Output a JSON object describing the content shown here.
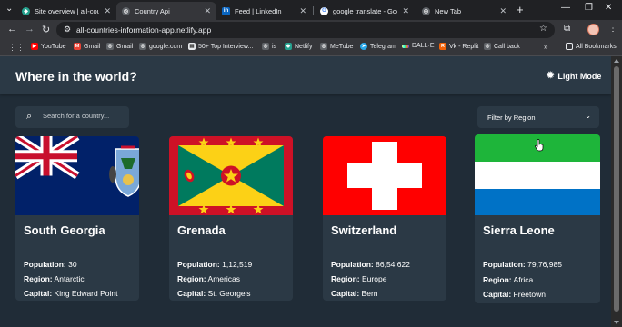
{
  "browser": {
    "tabs": [
      {
        "title": "Site overview | all-countries",
        "favicon": "netlify-icon"
      },
      {
        "title": "Country Api",
        "favicon": "globe-icon"
      },
      {
        "title": "Feed | LinkedIn",
        "favicon": "linkedin-icon"
      },
      {
        "title": "google translate - Google",
        "favicon": "google-icon"
      },
      {
        "title": "New Tab",
        "favicon": "chrome-icon"
      }
    ],
    "new_tab_label": "+",
    "url": "all-countries-information-app.netlify.app",
    "bookmarks": [
      {
        "label": "YouTube",
        "icon": "youtube-icon"
      },
      {
        "label": "Gmail",
        "icon": "gmail-icon"
      },
      {
        "label": "Gmail",
        "icon": "globe-icon"
      },
      {
        "label": "google.com",
        "icon": "globe-icon"
      },
      {
        "label": "50+ Top Interview...",
        "icon": "bookmark-icon"
      },
      {
        "label": "is",
        "icon": "globe-icon"
      },
      {
        "label": "Netlify",
        "icon": "netlify-icon"
      },
      {
        "label": "MeTube",
        "icon": "globe-icon"
      },
      {
        "label": "Telegram",
        "icon": "telegram-icon"
      },
      {
        "label": "DALL·E",
        "icon": "dalle-icon"
      },
      {
        "label": "Vk - Replit",
        "icon": "replit-icon"
      },
      {
        "label": "Call back",
        "icon": "globe-icon"
      }
    ],
    "all_bookmarks_label": "All Bookmarks"
  },
  "app": {
    "title": "Where in the world?",
    "mode_toggle_label": "Light Mode",
    "search_placeholder": "Search for a country...",
    "region_filter_label": "Filter by Region",
    "labels": {
      "population": "Population:",
      "region": "Region:",
      "capital": "Capital:"
    },
    "colors": {
      "background": "#202c37",
      "elements": "#2b3945",
      "text": "#ffffff"
    },
    "countries": [
      {
        "name": "South Georgia",
        "population": "30",
        "region": "Antarctic",
        "capital": "King Edward Point"
      },
      {
        "name": "Grenada",
        "population": "1,12,519",
        "region": "Americas",
        "capital": "St. George's"
      },
      {
        "name": "Switzerland",
        "population": "86,54,622",
        "region": "Europe",
        "capital": "Bern"
      },
      {
        "name": "Sierra Leone",
        "population": "79,76,985",
        "region": "Africa",
        "capital": "Freetown"
      }
    ]
  }
}
